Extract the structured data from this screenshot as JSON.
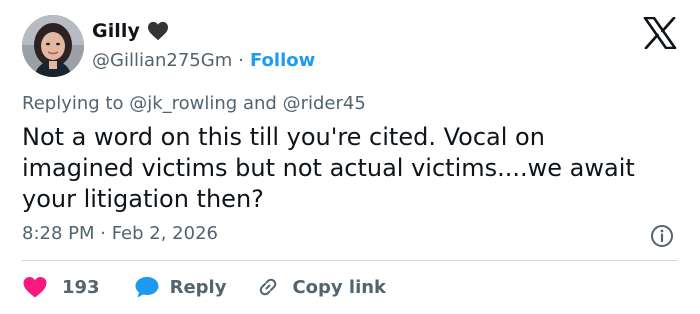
{
  "author": {
    "display_name": "Gilly",
    "handle": "@Gillian275Gm",
    "separator": "·",
    "follow_label": "Follow"
  },
  "reply_context": {
    "prefix": "Replying to",
    "mention_1": "@jk_rowling",
    "joiner": "and",
    "mention_2": "@rider45"
  },
  "tweet": {
    "lines": [
      "Not a word on this till you're cited. Vocal on",
      "imagined victims but not actual victims....we await",
      "your litigation then?"
    ],
    "timestamp": "8:28 PM · Feb 2, 2026"
  },
  "actions": {
    "like_count": "193",
    "reply_label": "Reply",
    "copy_label": "Copy link"
  },
  "colors": {
    "text": "#0f1419",
    "secondary": "#536471",
    "link": "#1d9bf0",
    "like": "#f91880",
    "reply": "#1d9bf0",
    "divider": "#cfd9de"
  },
  "icons": {
    "name_badge": "black-heart-icon",
    "brand": "x-logo-icon",
    "info": "info-icon",
    "like": "heart-icon",
    "reply": "speech-bubble-icon",
    "copy": "link-icon"
  }
}
